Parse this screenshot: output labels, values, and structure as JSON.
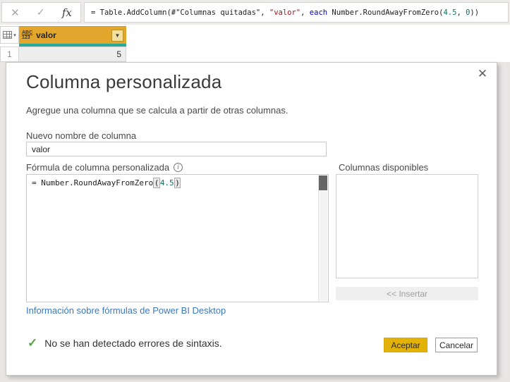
{
  "formula_bar": {
    "discard_icon": "✕",
    "commit_icon": "✓",
    "fx_icon": "fx",
    "segments": [
      {
        "t": "= Table.AddColumn(#\"Columnas quitadas\", ",
        "c": "plain"
      },
      {
        "t": "\"valor\"",
        "c": "string"
      },
      {
        "t": ", ",
        "c": "plain"
      },
      {
        "t": "each",
        "c": "keyword"
      },
      {
        "t": " Number.RoundAwayFromZero(",
        "c": "plain"
      },
      {
        "t": "4.5",
        "c": "number"
      },
      {
        "t": ", ",
        "c": "plain"
      },
      {
        "t": "0",
        "c": "number"
      },
      {
        "t": "))",
        "c": "plain"
      }
    ]
  },
  "grid": {
    "corner_dropdown_icon": "▾",
    "column": {
      "type_icon_line1": "ABC",
      "type_icon_line2": "123",
      "name": "valor",
      "filter_icon": "▼"
    },
    "rows": [
      {
        "index": "1",
        "value": "5"
      }
    ]
  },
  "dialog": {
    "close_icon": "✕",
    "title": "Columna personalizada",
    "description": "Agregue una columna que se calcula a partir de otras columnas.",
    "new_name_label": "Nuevo nombre de columna",
    "new_name_value": "valor",
    "formula_label": "Fórmula de columna personalizada",
    "info_icon": "i",
    "formula_segments": [
      {
        "t": "= Number.RoundAwayFromZero",
        "c": "plain"
      },
      {
        "t": "(",
        "c": "bracket"
      },
      {
        "t": "4.5",
        "c": "number"
      },
      {
        "t": ")",
        "c": "bracket"
      }
    ],
    "available_columns_label": "Columnas disponibles",
    "available_columns": [],
    "insert_button": "<< Insertar",
    "help_link": "Información sobre fórmulas de Power BI Desktop",
    "syntax_check_icon": "✓",
    "syntax_message": "No se han detectado errores de sintaxis.",
    "accept_button": "Aceptar",
    "cancel_button": "Cancelar"
  },
  "colors": {
    "header_gold": "#E2A62C",
    "accept_gold": "#E3B208",
    "selection_teal": "#2AA89A",
    "link_blue": "#3B79BD",
    "success_green": "#55A546",
    "token_string": "#A31515",
    "token_keyword": "#0000CC",
    "token_number": "#0F7464"
  }
}
